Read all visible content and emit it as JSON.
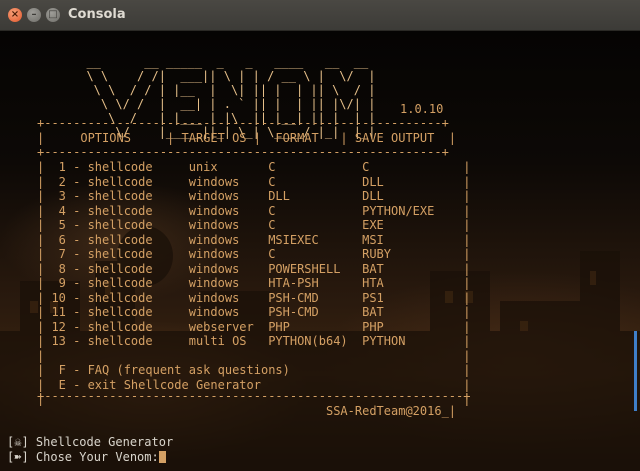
{
  "window": {
    "title": "Consola"
  },
  "art": [
    "  __      __ _____  _   _   ____   __  __",
    "  \\ \\    / /|  ___|| \\ | | / __ \\ |  \\/  |",
    "   \\ \\  / / | |__  |  \\| || |  | || \\  / |",
    "    \\ \\/ /  |  __| | . ` || |  | || |\\/| |",
    "     \\  /   | |___ | |\\  || |__| || |  | |",
    "      \\/    |_____||_| \\_| \\____/ |_|  |_|"
  ],
  "version": "1.0.10",
  "table": {
    "top_border": "+-------------------------------------------------------+",
    "header": "|     OPTIONS     | TARGET OS |  FORMAT   | SAVE OUTPUT  |",
    "mid_border": "+-------------------------------------------------------+",
    "rows": [
      "|  1 - shellcode     unix       C            C             |",
      "|  2 - shellcode     windows    C            DLL           |",
      "|  3 - shellcode     windows    DLL          DLL           |",
      "|  4 - shellcode     windows    C            PYTHON/EXE    |",
      "|  5 - shellcode     windows    C            EXE           |",
      "|  6 - shellcode     windows    MSIEXEC      MSI           |",
      "|  7 - shellcode     windows    C            RUBY          |",
      "|  8 - shellcode     windows    POWERSHELL   BAT           |",
      "|  9 - shellcode     windows    HTA-PSH      HTA           |",
      "| 10 - shellcode     windows    PSH-CMD      PS1           |",
      "| 11 - shellcode     windows    PSH-CMD      BAT           |",
      "| 12 - shellcode     webserver  PHP          PHP           |",
      "| 13 - shellcode     multi OS   PYTHON(b64)  PYTHON        |",
      "|                                                          |",
      "|  F - FAQ (frequent ask questions)                        |",
      "|  E - exit Shellcode Generator                            |",
      "|                                                          |"
    ],
    "bottom_border": "+----------------------------------------------------------+",
    "footer": "                                        SSA-RedTeam@2016_|"
  },
  "prompt": {
    "line1": "[☠] Shellcode Generator",
    "line2": "[➽] Chose Your Venom:"
  }
}
